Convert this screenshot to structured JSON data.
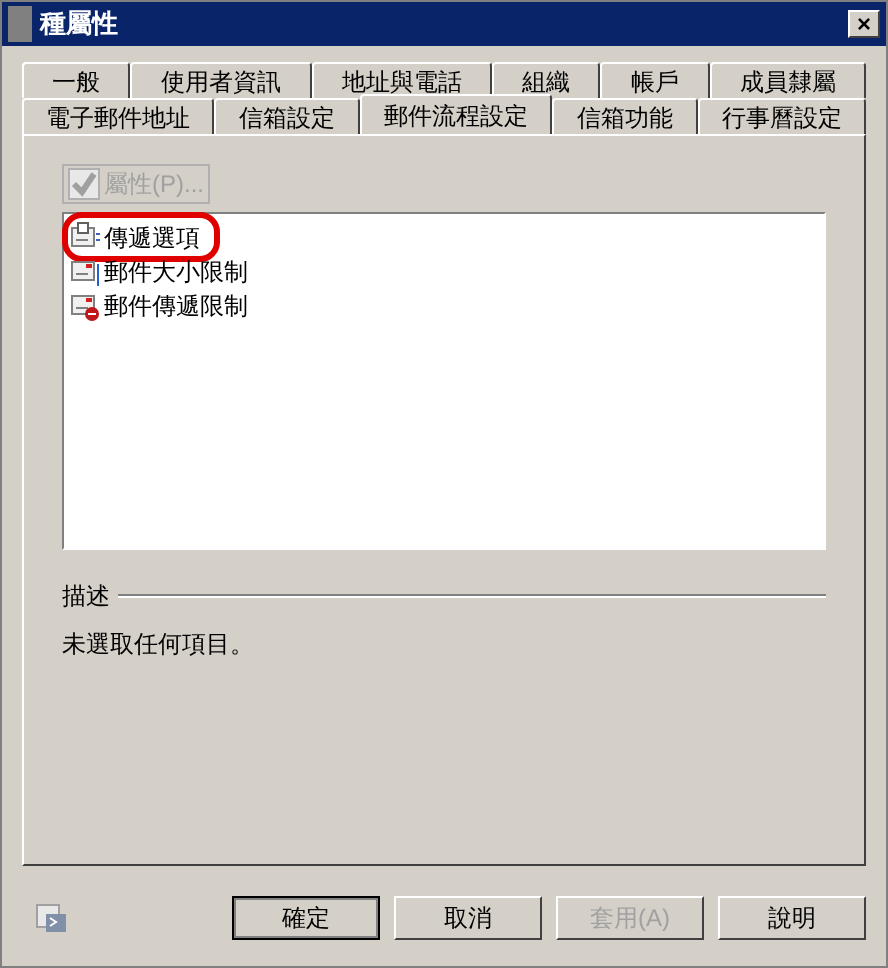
{
  "window": {
    "title": "種屬性",
    "close": "×"
  },
  "tab_rows": [
    [
      {
        "label": "一般",
        "selected": false
      },
      {
        "label": "使用者資訊",
        "selected": false
      },
      {
        "label": "地址與電話",
        "selected": false
      },
      {
        "label": "組織",
        "selected": false
      },
      {
        "label": "帳戶",
        "selected": false
      },
      {
        "label": "成員隸屬",
        "selected": false
      }
    ],
    [
      {
        "label": "電子郵件地址",
        "selected": false
      },
      {
        "label": "信箱設定",
        "selected": false
      },
      {
        "label": "郵件流程設定",
        "selected": true
      },
      {
        "label": "信箱功能",
        "selected": false
      },
      {
        "label": "行事曆設定",
        "selected": false
      }
    ]
  ],
  "properties_button": {
    "label": "屬性(P)...",
    "disabled": true
  },
  "list": [
    {
      "label": "傳遞選項",
      "kind": "delivery",
      "annotated": true
    },
    {
      "label": "郵件大小限制",
      "kind": "size",
      "annotated": false
    },
    {
      "label": "郵件傳遞限制",
      "kind": "restriction",
      "annotated": false
    }
  ],
  "description": {
    "heading": "描述",
    "text": "未選取任何項目。"
  },
  "buttons": [
    {
      "label": "確定",
      "default": true,
      "disabled": false
    },
    {
      "label": "取消",
      "default": false,
      "disabled": false
    },
    {
      "label": "套用(A)",
      "default": false,
      "disabled": true
    },
    {
      "label": "說明",
      "default": false,
      "disabled": false
    }
  ]
}
